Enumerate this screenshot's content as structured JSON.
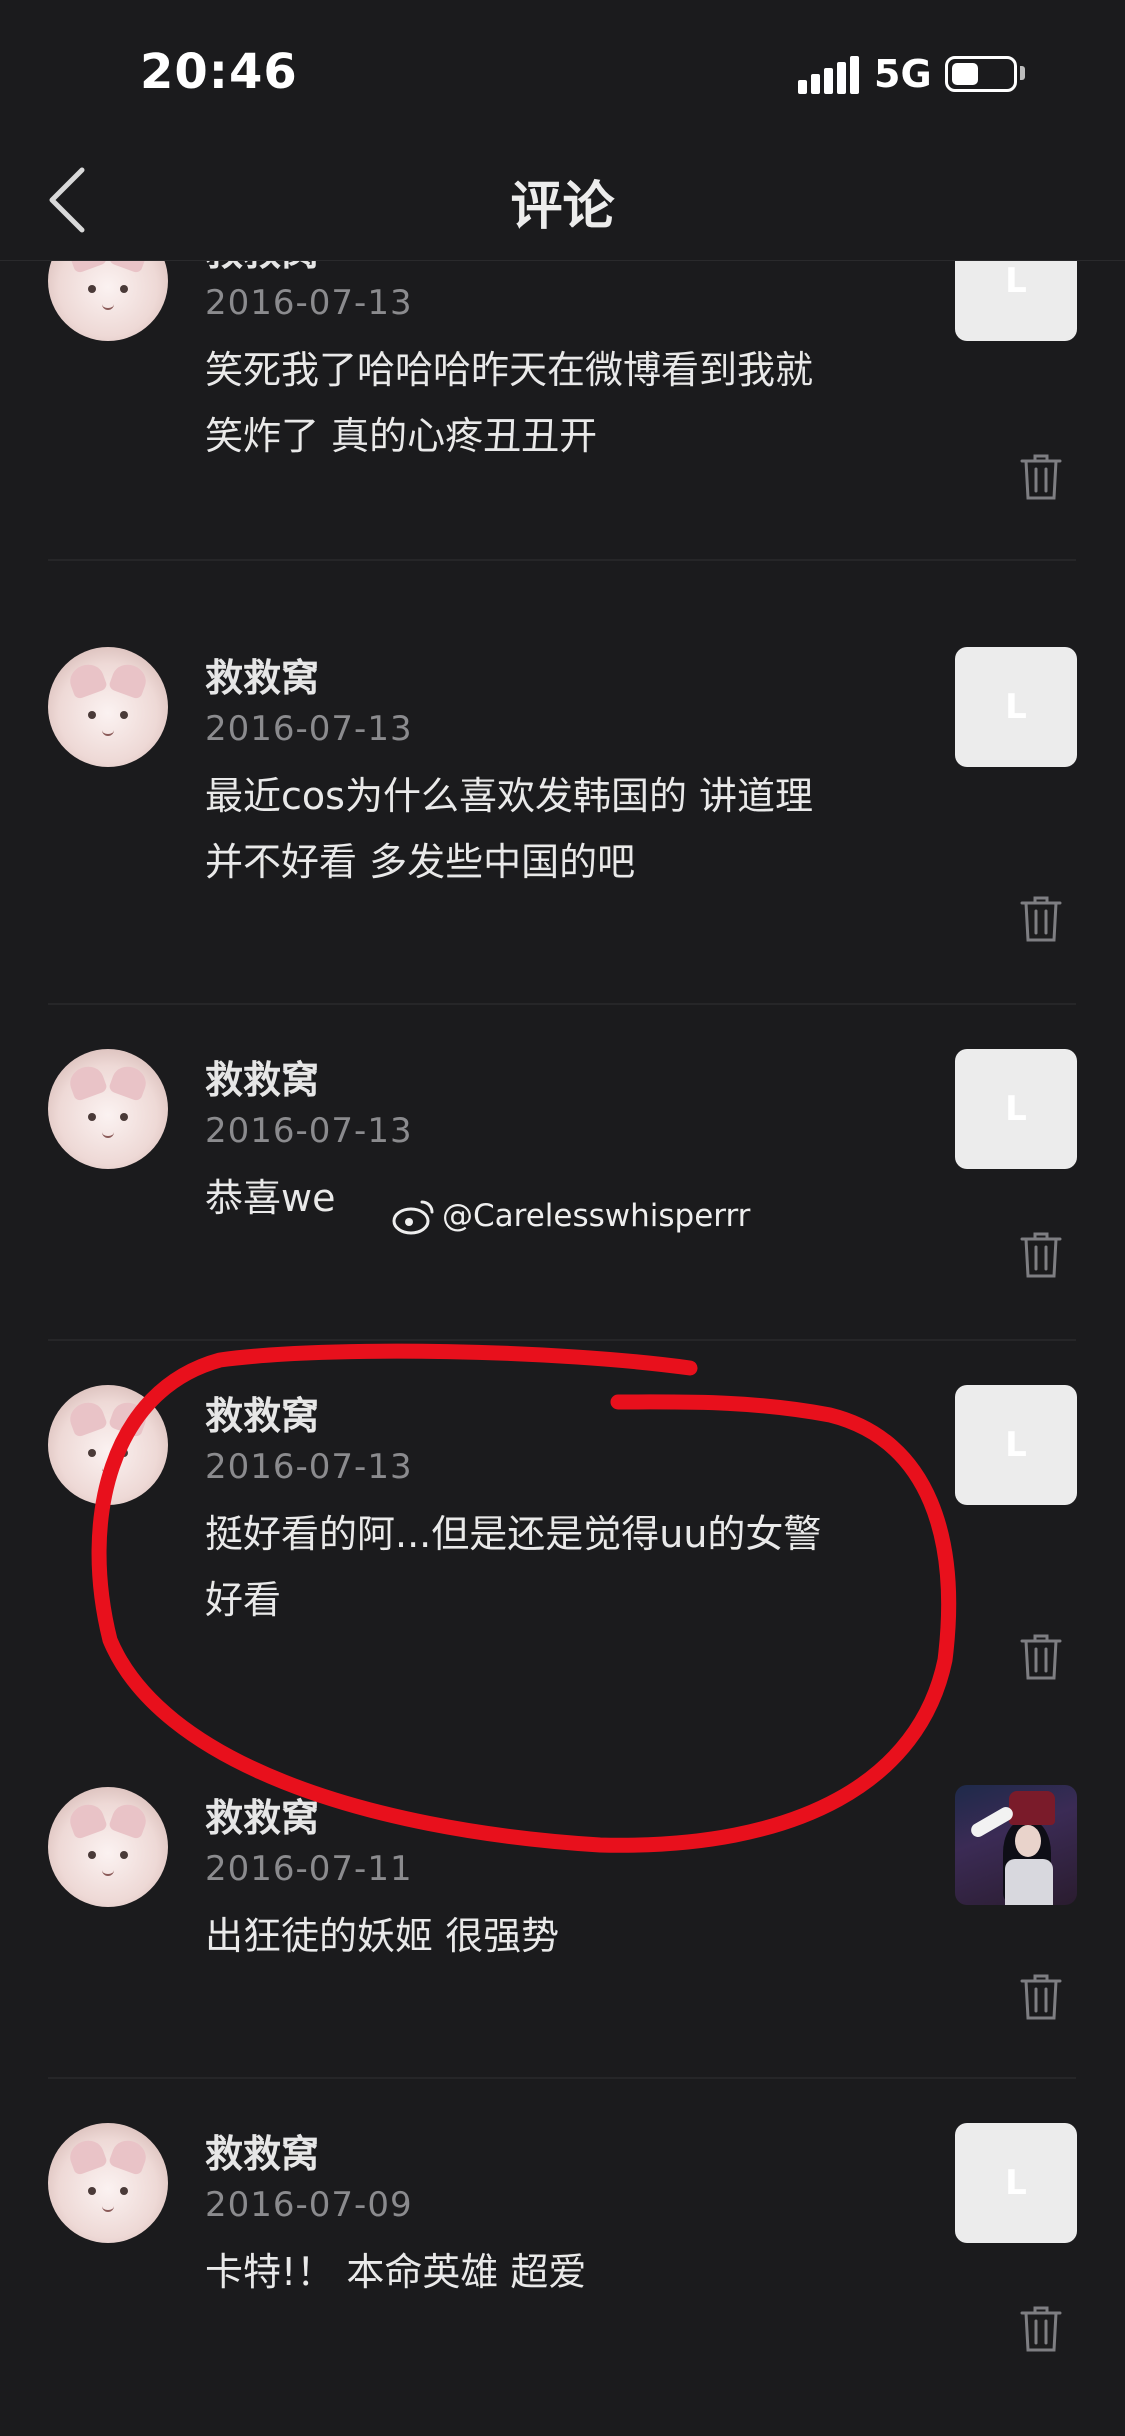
{
  "status_bar": {
    "time": "20:46",
    "network": "5G"
  },
  "nav": {
    "title": "评论"
  },
  "comments": [
    {
      "username": "救救窝",
      "date": "2016-07-13",
      "text_lines": [
        "笑死我了哈哈哈昨天在微博看到我就",
        "笑炸了 真的心疼丑丑开"
      ],
      "thumb_glyph": "L",
      "thumb_type": "blank"
    },
    {
      "username": "救救窝",
      "date": "2016-07-13",
      "text_lines": [
        "最近cos为什么喜欢发韩国的 讲道理",
        "并不好看 多发些中国的吧"
      ],
      "thumb_glyph": "L",
      "thumb_type": "blank"
    },
    {
      "username": "救救窝",
      "date": "2016-07-13",
      "text_lines": [
        "恭喜we"
      ],
      "thumb_glyph": "L",
      "thumb_type": "blank"
    },
    {
      "username": "救救窝",
      "date": "2016-07-13",
      "text_lines": [
        "挺好看的阿...但是还是觉得uu的女警",
        "好看"
      ],
      "thumb_glyph": "L",
      "thumb_type": "blank"
    },
    {
      "username": "救救窝",
      "date": "2016-07-11",
      "text_lines": [
        "出狂徒的妖姬 很强势"
      ],
      "thumb_glyph": "",
      "thumb_type": "photo"
    },
    {
      "username": "救救窝",
      "date": "2016-07-09",
      "text_lines": [
        "卡特!！ 本命英雄 超爱"
      ],
      "thumb_glyph": "L",
      "thumb_type": "blank"
    }
  ],
  "watermark": {
    "text": "@Carelesswhisperrr"
  },
  "annotation": {
    "color": "#e8101c"
  },
  "colors": {
    "background": "#1b1b1d",
    "muted_text": "#8b8b8e",
    "divider": "#262628"
  }
}
